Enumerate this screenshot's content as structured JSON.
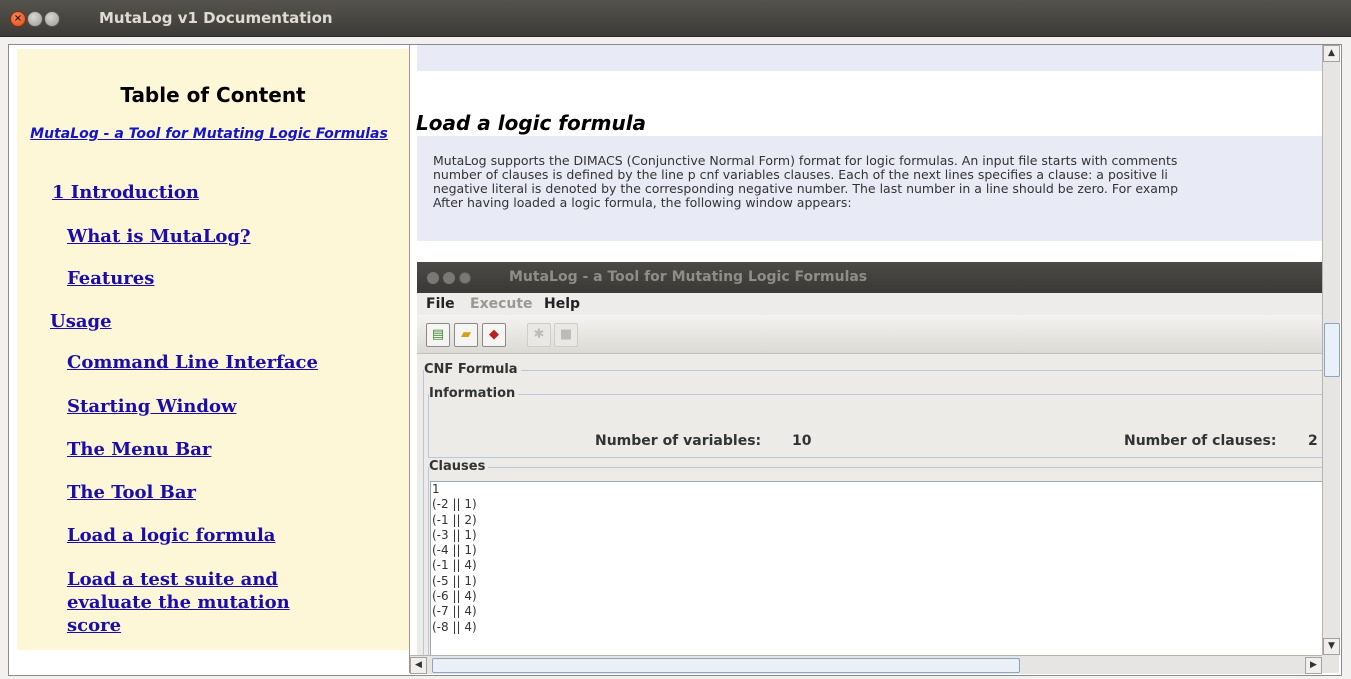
{
  "window": {
    "title": "MutaLog v1 Documentation"
  },
  "toc": {
    "title": "Table of Content",
    "subtitle": "MutaLog - a Tool for Mutating Logic Formulas",
    "items": [
      {
        "label": "1 Introduction"
      },
      {
        "label": "What is MutaLog?"
      },
      {
        "label": "Features"
      },
      {
        "label": "Usage"
      },
      {
        "label": "Command Line Interface "
      },
      {
        "label": "Starting Window "
      },
      {
        "label": "The Menu Bar "
      },
      {
        "label": "The Tool Bar "
      },
      {
        "label": "Load a logic formula "
      },
      {
        "label": "Load a test suite and evaluate the mutation score "
      }
    ]
  },
  "section": {
    "title": "Load a logic formula",
    "lines": [
      "MutaLog supports the DIMACS (Conjunctive Normal Form) format for logic formulas. An input file starts with comments",
      "number of clauses is defined by the line p cnf variables clauses. Each of the next lines specifies a clause: a positive li",
      "negative literal is denoted by the corresponding negative number. The last number in a line should be zero. For examp",
      "After having loaded a logic formula, the following window appears:"
    ]
  },
  "embedded": {
    "title": "MutaLog - a Tool for Mutating Logic Formulas",
    "menu": {
      "file": "File",
      "execute": "Execute",
      "help": "Help"
    },
    "group_cnf": "CNF Formula",
    "group_info": "Information",
    "vars_label": "Number of variables:",
    "vars_value": "10",
    "clauses_label": "Number of clauses:",
    "clauses_value": "2",
    "group_clauses": "Clauses",
    "clauses": [
      "1",
      "(-2 || 1)",
      "(-1 || 2)",
      "(-3 || 1)",
      "(-4 || 1)",
      "(-1 || 4)",
      "(-5 || 1)",
      "(-6 || 4)",
      "(-7 || 4)",
      "(-8 || 4)"
    ]
  },
  "icons": {
    "close": "close-icon",
    "minimize": "minimize-icon",
    "maximize": "maximize-icon"
  }
}
